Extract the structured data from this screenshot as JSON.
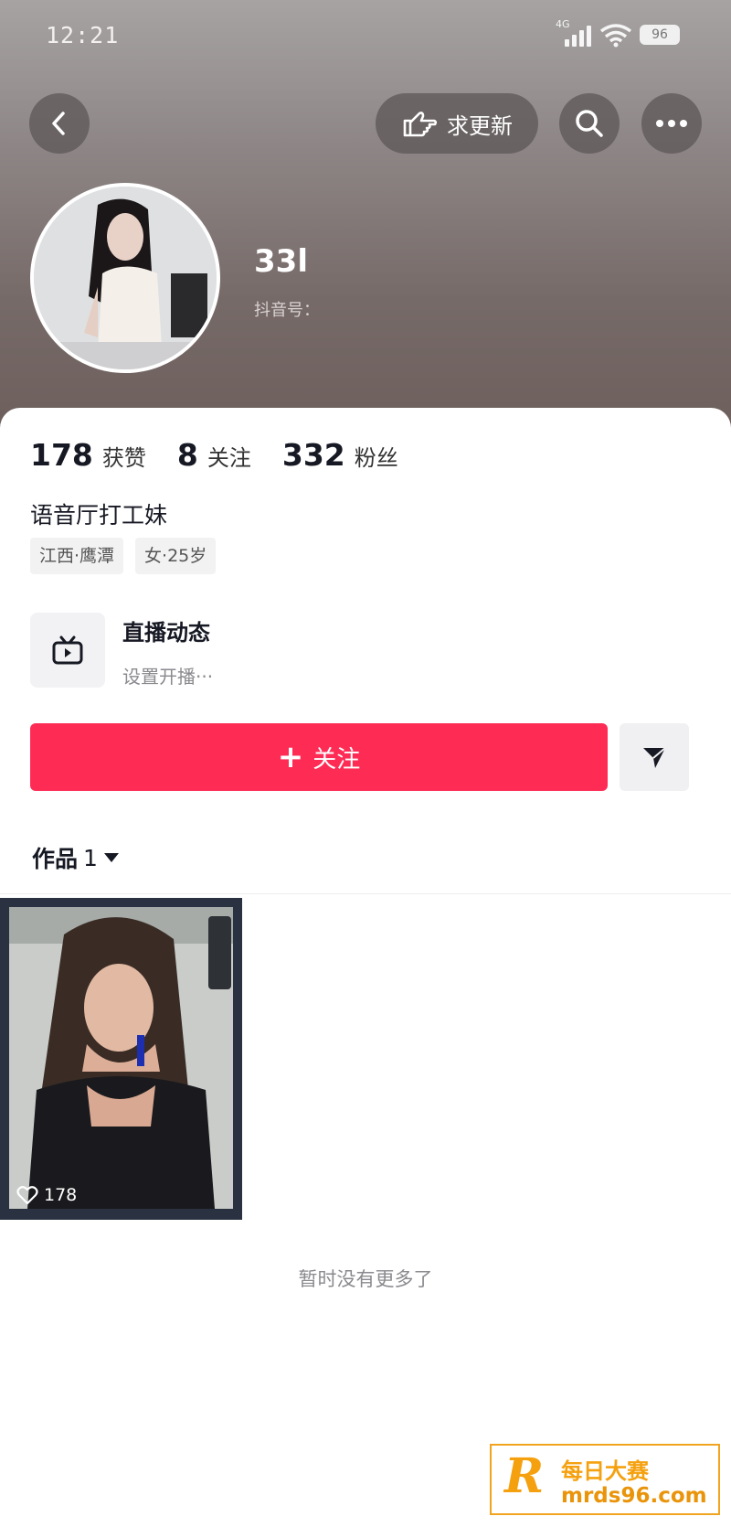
{
  "status_bar": {
    "time": "12:21",
    "network": "4G",
    "battery": "96"
  },
  "top_bar": {
    "back_icon": "chevron-left-icon",
    "request_update_label": "求更新",
    "request_update_icon": "pointing-hand-icon",
    "search_icon": "search-icon",
    "more_icon": "more-dots-icon"
  },
  "profile": {
    "name": "33l",
    "douyin_id": "抖音号：",
    "avatar": "avatar-photo"
  },
  "stats": [
    {
      "value": "178",
      "label": "获赞"
    },
    {
      "value": "8",
      "label": "关注"
    },
    {
      "value": "332",
      "label": "粉丝"
    }
  ],
  "bio": "语音厅打工妹",
  "tags": [
    "江西·鹰潭",
    "女·25岁"
  ],
  "live": {
    "title": "直播动态",
    "subtitle": "设置开播···",
    "icon": "tv-icon"
  },
  "follow_button": {
    "label": "关注",
    "plus": "+"
  },
  "share_icon": "send-icon",
  "works_tab": {
    "label": "作品",
    "count": "1"
  },
  "videos": [
    {
      "likes": "178"
    }
  ],
  "no_more_text": "暂时没有更多了",
  "watermark": {
    "logo": "R",
    "cn": "每日大赛",
    "url": "mrds96.com"
  },
  "colors": {
    "accent": "#fe2c55",
    "watermark": "#f5a10f"
  }
}
